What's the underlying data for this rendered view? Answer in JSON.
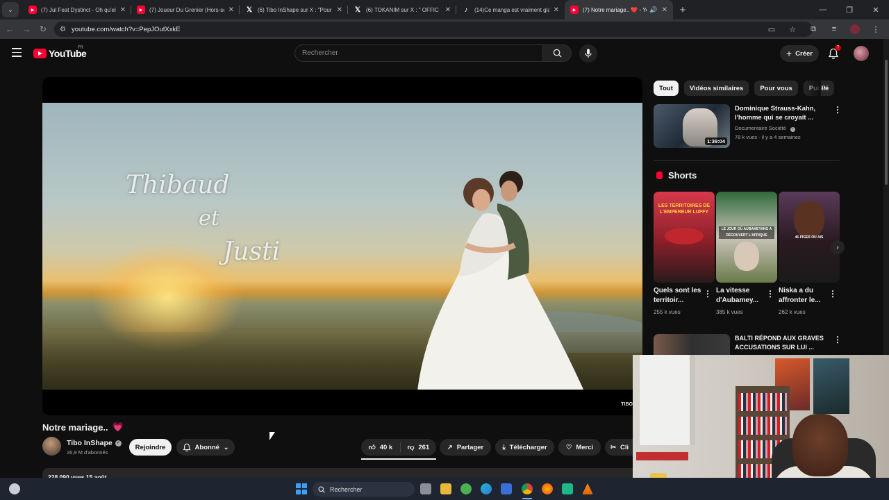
{
  "browser": {
    "tabs": [
      {
        "title": "(7) Jul Feat Dystinct - Oh qu'elle",
        "icon": "youtube-icon",
        "active": false
      },
      {
        "title": "(7) Joueur Du Grenier (Hors-sé",
        "icon": "youtube-icon",
        "active": false
      },
      {
        "title": "(6) Tibo InShape sur X : \"Pour s",
        "icon": "x-icon",
        "active": false
      },
      {
        "title": "(6) TOKANIM sur X : \" OFFIC",
        "icon": "x-icon",
        "active": false
      },
      {
        "title": "(14)Ce manga est vraiment gla",
        "icon": "tiktok-icon",
        "active": false
      },
      {
        "title": "(7) Notre mariage.. ❤️ - Yo",
        "icon": "youtube-icon",
        "active": true
      }
    ],
    "url": "youtube.com/watch?v=PepJOufXxkE"
  },
  "youtube": {
    "logo_text": "YouTube",
    "country": "FR",
    "search_placeholder": "Rechercher",
    "create_label": "Créer",
    "notif_count": "7"
  },
  "video": {
    "overlay_lines": [
      "Thibaud",
      "et",
      "Justi"
    ],
    "watermark": "TIBO",
    "title": "Notre mariage..",
    "title_emoji": "💗",
    "channel_name": "Tibo InShape",
    "subscribers": "26,9 M d'abonnés",
    "join_label": "Rejoindre",
    "subscribed_label": "Abonné",
    "likes": "40 k",
    "dislikes": "261",
    "share_label": "Partager",
    "download_label": "Télécharger",
    "thanks_label": "Merci",
    "clip_label": "Cli",
    "description_meta": "228 090 vues  15 août"
  },
  "sidebar": {
    "chips": [
      "Tout",
      "Vidéos similaires",
      "Pour vous",
      "Publié"
    ],
    "rec1": {
      "title": "Dominique Strauss-Kahn, l'homme qui se croyait ...",
      "channel": "Documentaire Société",
      "meta": "78 k vues · il y a 4 semaines",
      "duration": "1:39:04"
    },
    "shorts_heading": "Shorts",
    "shorts": [
      {
        "title": "Quels sont les territoir...",
        "views": "255 k vues",
        "overlay": "LES TERRITOIRES DE L'EMPEREUR LUFFY"
      },
      {
        "title": "La vitesse d'Aubamey...",
        "views": "385 k vues",
        "overlay": "LE JOUR OÙ AUBAMEYANG A DÉCOUVERT L'AFRIQUE"
      },
      {
        "title": "Niska a du affronter le...",
        "views": "262 k vues",
        "overlay": "46 PIGES OU AIS"
      }
    ],
    "rec2": {
      "title": "BALTI RÉPOND AUX GRAVES ACCUSATIONS SUR LUI ..."
    }
  },
  "taskbar": {
    "search_label": "Rechercher"
  },
  "colors": {
    "brand_red": "#ff0033",
    "background": "#0f0f0f",
    "accent_pink": "#ff4f9a"
  }
}
